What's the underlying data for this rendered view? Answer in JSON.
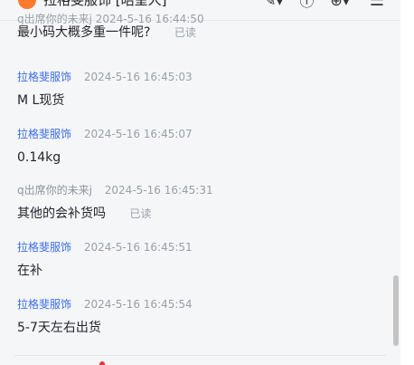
{
  "header": {
    "title": "拉格斐服饰 [昭呈人]",
    "icons": [
      "edit-icon",
      "info-icon",
      "add-icon",
      "menu-icon"
    ]
  },
  "cutoff_message_meta": "q出席你的未来j  2024-5-16 16:44:50",
  "messages": [
    {
      "sender": "",
      "time": "",
      "text": "最小码大概多重一件呢?",
      "read": "已读",
      "from": "user"
    },
    {
      "sender": "拉格斐服饰",
      "time": "2024-5-16 16:45:03",
      "text": "M  L现货",
      "read": "",
      "from": "shop"
    },
    {
      "sender": "拉格斐服饰",
      "time": "2024-5-16 16:45:07",
      "text": "0.14kg",
      "read": "",
      "from": "shop"
    },
    {
      "sender": "q出席你的未来j",
      "time": "2024-5-16 16:45:31",
      "text": "其他的会补货吗",
      "read": "已读",
      "from": "user"
    },
    {
      "sender": "拉格斐服饰",
      "time": "2024-5-16 16:45:51",
      "text": "在补",
      "read": "",
      "from": "shop"
    },
    {
      "sender": "拉格斐服饰",
      "time": "2024-5-16 16:45:54",
      "text": "5-7天左右出货",
      "read": "",
      "from": "shop"
    }
  ],
  "colors": {
    "shop_name": "#3a6ee8",
    "user_name": "#8f959e",
    "timestamp": "#9aa0a6",
    "background": "#f5f6f8"
  }
}
